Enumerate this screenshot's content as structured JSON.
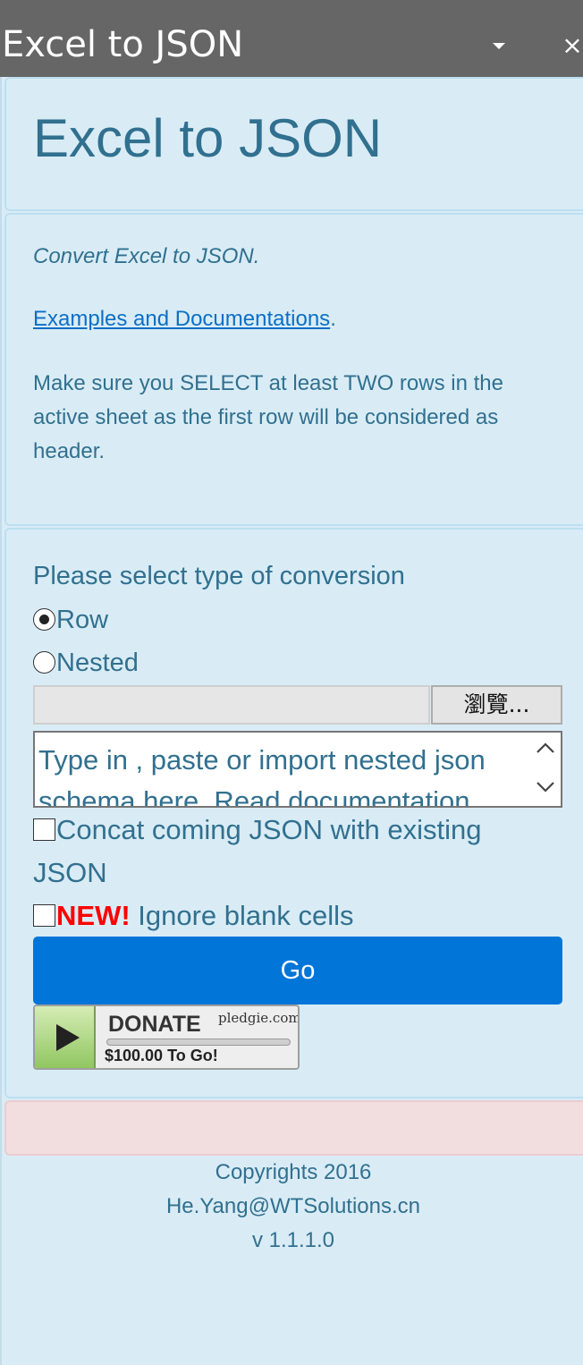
{
  "window": {
    "title": "Excel to JSON",
    "close_icon": "×",
    "menu_icon": "chevron-down-icon"
  },
  "header": {
    "heading": "Excel to JSON"
  },
  "info": {
    "tagline": "Convert Excel to JSON.",
    "doc_link": "Examples and Documentations",
    "doc_link_suffix": ".",
    "note": "Make sure you SELECT at least TWO rows in the active sheet as the first row will be considered as header."
  },
  "form": {
    "conversion_label": "Please select type of conversion",
    "radio_options": [
      {
        "label": "Row",
        "checked": true
      },
      {
        "label": "Nested",
        "checked": false
      }
    ],
    "file_input_value": "",
    "browse_label": "瀏覽...",
    "schema_placeholder": "Type in , paste or import nested json schema here. Read documentation",
    "concat_label": "Concat coming JSON with existing JSON",
    "new_badge": "NEW!",
    "ignore_label": " Ignore blank cells",
    "go_label": "Go"
  },
  "donate": {
    "label": "DONATE",
    "brand": "pledgie.com",
    "goal_text": "$100.00 To Go!"
  },
  "footer": {
    "copyright": "Copyrights 2016",
    "email": "He.Yang@WTSolutions.cn",
    "version": "v 1.1.1.0"
  },
  "colors": {
    "title_bar": "#666666",
    "pane_background": "#d9ecf6",
    "text": "#31708f",
    "link": "#0b6fc6",
    "go_button": "#0275d8",
    "new_badge": "#ff0000",
    "alert_background": "#f2dede"
  }
}
